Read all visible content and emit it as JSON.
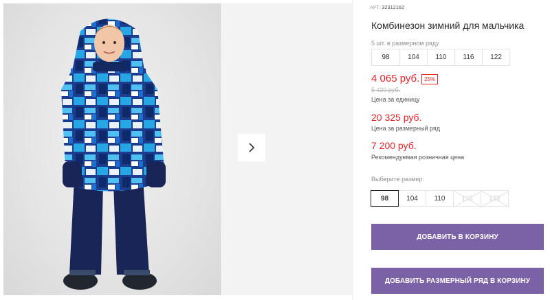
{
  "gallery": {
    "main_image": "boy-winter-jumpsuit-photo",
    "next_icon": "chevron-right-icon"
  },
  "product": {
    "sku_label": "АРТ.",
    "sku_value": "32312162",
    "title": "Комбинезон зимний для мальчика",
    "series_label": "5 шт. в размерном ряду",
    "series_sizes": [
      "98",
      "104",
      "110",
      "116",
      "122"
    ],
    "price": "4 065 руб.",
    "discount": "25%",
    "old_price": "5 420 руб.",
    "unit_caption": "Цена за единицу",
    "series_price": "20 325 руб.",
    "series_caption": "Цена за размерный ряд",
    "retail_price": "7 200 руб.",
    "retail_caption": "Рекомендуемая розничная цена"
  },
  "size_picker": {
    "label": "Выберите размер:",
    "options": [
      {
        "size": "98",
        "state": "selected"
      },
      {
        "size": "104",
        "state": "available"
      },
      {
        "size": "110",
        "state": "available"
      },
      {
        "size": "116",
        "state": "disabled"
      },
      {
        "size": "122",
        "state": "disabled"
      }
    ]
  },
  "actions": {
    "add_to_cart": "ДОБАВИТЬ В КОРЗИНУ",
    "add_series_to_cart": "ДОБАВИТЬ РАЗМЕРНЫЙ РЯД В КОРЗИНУ"
  },
  "colors": {
    "accent_button": "#7b61a6",
    "price_red": "#e2262b"
  }
}
